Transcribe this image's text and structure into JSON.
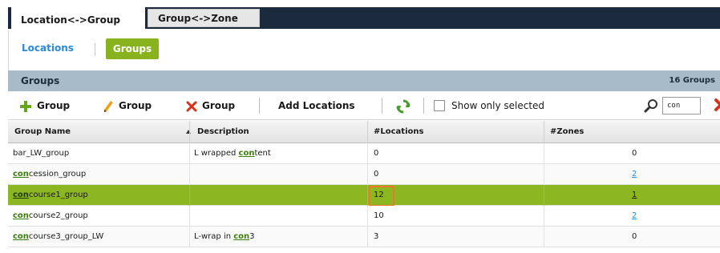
{
  "tabs": [
    {
      "label": "Location<->Group",
      "active": true
    },
    {
      "label": "Group<->Zone",
      "active": false
    }
  ],
  "subnav": {
    "locations_label": "Locations",
    "groups_label": "Groups"
  },
  "section": {
    "title": "Groups",
    "count": "16 Groups"
  },
  "toolbar": {
    "add_label": "Group",
    "edit_label": "Group",
    "delete_label": "Group",
    "add_locations_label": "Add Locations",
    "show_only_selected_label": "Show only selected",
    "search_value": "con"
  },
  "table": {
    "columns": [
      "Group Name",
      "Description",
      "#Locations",
      "#Zones"
    ],
    "rows": [
      {
        "name_hl": "",
        "name_rest": "bar_LW_group",
        "desc_pre": "L wrapped ",
        "desc_hl": "con",
        "desc_post": "tent",
        "locations": "0",
        "zones": "0",
        "zones_link": false,
        "selected": false
      },
      {
        "name_hl": "con",
        "name_rest": "cession_group",
        "desc_pre": "",
        "desc_hl": "",
        "desc_post": "",
        "locations": "0",
        "zones": "2",
        "zones_link": true,
        "selected": false
      },
      {
        "name_hl": "con",
        "name_rest": "course1_group",
        "desc_pre": "",
        "desc_hl": "",
        "desc_post": "",
        "locations": "12",
        "zones": "1",
        "zones_link": true,
        "selected": true
      },
      {
        "name_hl": "con",
        "name_rest": "course2_group",
        "desc_pre": "",
        "desc_hl": "",
        "desc_post": "",
        "locations": "10",
        "zones": "2",
        "zones_link": true,
        "selected": false
      },
      {
        "name_hl": "con",
        "name_rest": "course3_group_LW",
        "desc_pre": "L-wrap in ",
        "desc_hl": "con",
        "desc_post": "3",
        "locations": "3",
        "zones": "0",
        "zones_link": false,
        "selected": false
      }
    ]
  },
  "colors": {
    "accent_green": "#89b21f",
    "selected_row": "#8db720",
    "header_band": "#a7bcc8",
    "link_blue": "#2b8ad6",
    "highlight_box": "#f0782a"
  }
}
